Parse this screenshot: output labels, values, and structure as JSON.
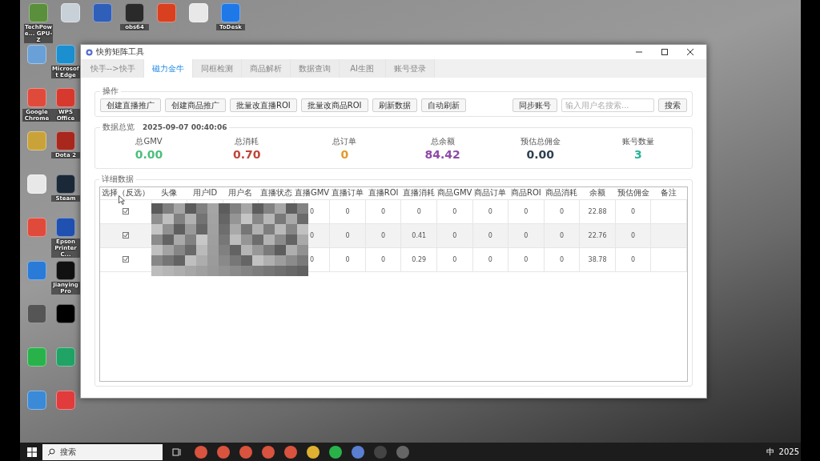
{
  "desktop": {
    "icons": [
      {
        "label": "TechPowe... GPU-Z",
        "kind": "gpu"
      },
      {
        "kind": "bin"
      },
      {
        "kind": "monitor"
      },
      {
        "label": "obs64",
        "kind": "obs"
      },
      {
        "kind": "live"
      },
      {
        "kind": "file"
      },
      {
        "label": "ToDesk",
        "kind": "todesk"
      },
      {
        "kind": "map"
      },
      {
        "label": "Microsoft Edge",
        "kind": "edge"
      },
      {
        "label": "Google Chrome",
        "kind": "chrome"
      },
      {
        "label": "WPS Office",
        "kind": "wps"
      },
      {
        "kind": "folder"
      },
      {
        "label": "Dota 2",
        "kind": "dota"
      },
      {
        "kind": "file"
      },
      {
        "label": "Steam",
        "kind": "steam"
      },
      {
        "kind": "chrome"
      },
      {
        "label": "Epson Printer C...",
        "kind": "epson"
      },
      {
        "kind": "iu"
      },
      {
        "label": "JianyingPro",
        "kind": "capcut"
      },
      {
        "kind": "gauge"
      },
      {
        "kind": "tiktok"
      },
      {
        "kind": "wechat"
      },
      {
        "kind": "sheet"
      },
      {
        "kind": "pc"
      },
      {
        "kind": "pdf"
      }
    ]
  },
  "window": {
    "title": "快剪矩阵工具"
  },
  "tabs": [
    {
      "label": "快手-->快手",
      "selected": false
    },
    {
      "label": "磁力金牛",
      "selected": true
    },
    {
      "label": "同框检测",
      "selected": false
    },
    {
      "label": "商品解析",
      "selected": false
    },
    {
      "label": "数据查询",
      "selected": false
    },
    {
      "label": "AI生图",
      "selected": false
    },
    {
      "label": "账号登录",
      "selected": false
    }
  ],
  "actions": {
    "title": "操作",
    "buttons": [
      "创建直播推广",
      "创建商品推广",
      "批量改直播ROI",
      "批量改商品ROI",
      "刷新数据",
      "自动刷新"
    ],
    "sync_button": "同步账号",
    "search": {
      "placeholder": "输入用户名搜索..."
    },
    "search_button": "搜索"
  },
  "overview": {
    "title": "数据总览",
    "timestamp": "2025-09-07 00:40:06",
    "stats": [
      {
        "label": "总GMV",
        "value": "0.00",
        "color": "#4cbf7a"
      },
      {
        "label": "总消耗",
        "value": "0.70",
        "color": "#c0453a"
      },
      {
        "label": "总订单",
        "value": "0",
        "color": "#e39a2a"
      },
      {
        "label": "总余额",
        "value": "84.42",
        "color": "#8e4aa8"
      },
      {
        "label": "预估总佣金",
        "value": "0.00",
        "color": "#2e3e50"
      },
      {
        "label": "账号数量",
        "value": "3",
        "color": "#2ab39a"
      }
    ]
  },
  "details": {
    "title": "详细数据",
    "columns": [
      "选择（反选）",
      "头像",
      "用户ID",
      "用户名",
      "直播状态",
      "直播GMV",
      "直播订单",
      "直播ROI",
      "直播消耗",
      "商品GMV",
      "商品订单",
      "商品ROI",
      "商品消耗",
      "余额",
      "预估佣金",
      "备注"
    ],
    "rows": [
      {
        "checked": true,
        "cells": [
          "",
          "",
          "",
          "",
          "",
          "0",
          "0",
          "0",
          "0",
          "0",
          "0",
          "0",
          "0",
          "22.88",
          "0"
        ]
      },
      {
        "checked": true,
        "cells": [
          "",
          "",
          "",
          "",
          "",
          "0",
          "0",
          "0",
          "0.41",
          "0",
          "0",
          "0",
          "0",
          "22.76",
          "0"
        ]
      },
      {
        "checked": true,
        "cells": [
          "",
          "",
          "",
          "",
          "",
          "0",
          "0",
          "0",
          "0.29",
          "0",
          "0",
          "0",
          "0",
          "38.78",
          "0"
        ]
      }
    ]
  },
  "taskbar": {
    "search": {
      "placeholder": "搜索"
    },
    "tray_text": "中",
    "clock": "2025"
  }
}
